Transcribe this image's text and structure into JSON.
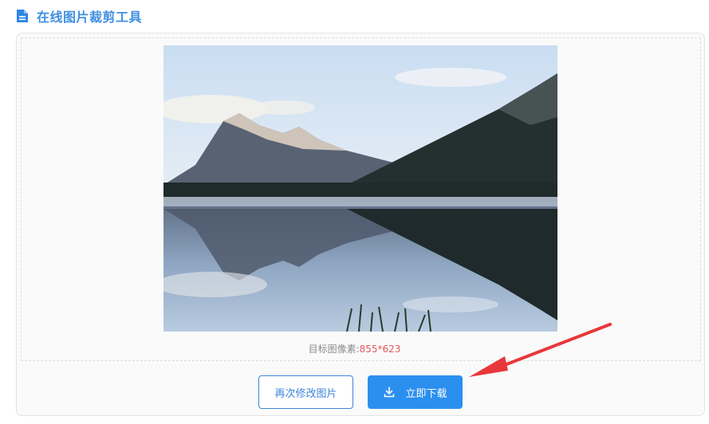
{
  "header": {
    "icon": "document-icon",
    "title": "在线图片裁剪工具",
    "accent_color": "#3f8fe0"
  },
  "preview": {
    "image_description_icon": "landscape-photo",
    "target_label": "目标图像素:",
    "target_value": "855*623",
    "target_value_color": "#e35a5a"
  },
  "actions": {
    "modify_label": "再次修改图片",
    "download_label": "立即下载",
    "download_icon": "download-icon",
    "primary_color": "#2b8ff0"
  },
  "annotation": {
    "arrow_color": "#e8373a"
  }
}
